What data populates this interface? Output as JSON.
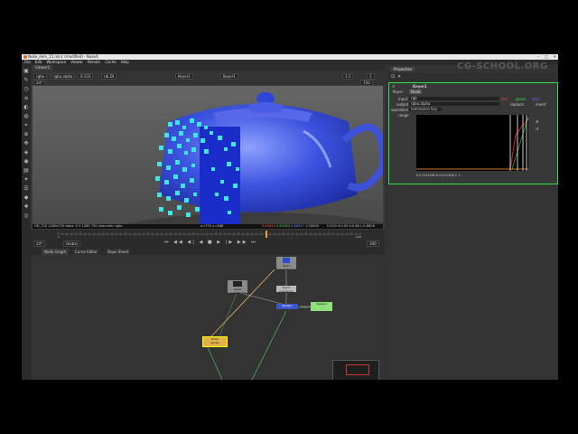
{
  "window": {
    "title": "Nuke_dem_15.nknc (modified) - NukeX",
    "controls": [
      "–",
      "□",
      "✕"
    ]
  },
  "menu": [
    "File",
    "Edit",
    "Workspace",
    "Viewer",
    "Render",
    "Cache",
    "Help"
  ],
  "watermark": "CG-SCHOOL.ORG",
  "viewer": {
    "tab": "Viewer1",
    "channels": "rgba",
    "channels2": "rgba.alpha",
    "gain": "0.333",
    "input": "rib.Dt",
    "view": "Keyer1",
    "view_b": "Keyer1",
    "frame": "1",
    "zoom": "1:1",
    "res": "720",
    "info_left": "HD_720 1280x720  bbox: 0 0 1280 720  channels: rgba",
    "info_pos": "x=770 y=488",
    "info_red": "0.84640",
    "info_green": "0.83164",
    "info_blue": "0.86347",
    "info_alpha": "1.00000",
    "info_hsv": "H:209 S:0.05 V:0.86  L:0.8626",
    "timeline_start": "1",
    "timeline_end": "100",
    "fps": "24*",
    "range": "Global",
    "end_field": "100"
  },
  "nodegraph": {
    "tabs": [
      "Node Graph",
      "Curve Editor",
      "Dope Sheet"
    ],
    "nodes": {
      "read1": "Read1\nteapot.####.exr",
      "read2": "Read2\nbg.####.exr",
      "keyer": "Keyer1\n(luminance)",
      "merge": "Merge1",
      "viewer": "Viewer1",
      "write": "Write1\n(render)",
      "shuffle": "Shuffle"
    },
    "edge_label": "Viewer1"
  },
  "properties": {
    "title": "Properties",
    "node_name": "Keyer1",
    "tabs": [
      "Keyer",
      "Node"
    ],
    "input_label": "input",
    "input_value": "rgb",
    "output_label": "output",
    "output_value": "rgba.alpha",
    "operation_label": "operation",
    "operation_value": "luminance key",
    "range_label": "range",
    "channel_opts": [
      "red",
      "green",
      "blue"
    ],
    "replace_label": "replace",
    "invert_label": "invert",
    "graph_readout": "A 0.7452368  B 0.9472838  C 1",
    "graph_c": "1"
  },
  "colors": {
    "accent_green": "#2ee14a",
    "graph_red": "#e02020",
    "graph_green": "#3cdc3c",
    "teapot": "#3a52e0"
  }
}
